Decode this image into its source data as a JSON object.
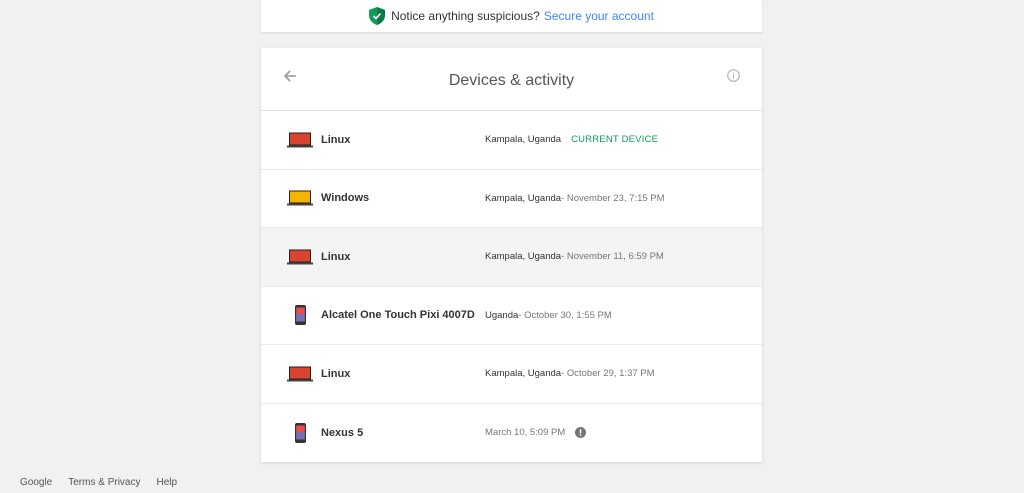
{
  "notice": {
    "text": "Notice anything suspicious?",
    "link": "Secure your account",
    "icon": "shield-icon"
  },
  "card": {
    "title": "Devices & activity",
    "back_icon": "arrow-back-icon",
    "info_icon": "info-icon"
  },
  "devices": [
    {
      "name": "Linux",
      "type": "laptop",
      "color": "#d9432f",
      "location": "Kampala, Uganda",
      "time": "",
      "current": "CURRENT DEVICE",
      "alert": false
    },
    {
      "name": "Windows",
      "type": "laptop",
      "color": "#f4b400",
      "location": "Kampala, Uganda",
      "time": " - November 23, 7:15 PM",
      "current": "",
      "alert": false
    },
    {
      "name": "Linux",
      "type": "laptop",
      "color": "#d9432f",
      "location": "Kampala, Uganda",
      "time": " - November 11, 6:59 PM",
      "current": "",
      "alert": false
    },
    {
      "name": "Alcatel One Touch Pixi 4007D",
      "type": "phone",
      "color": "#e84d4d",
      "location": "Uganda",
      "time": " - October 30, 1:55 PM",
      "current": "",
      "alert": false
    },
    {
      "name": "Linux",
      "type": "laptop",
      "color": "#d9432f",
      "location": "Kampala, Uganda",
      "time": " - October 29, 1:37 PM",
      "current": "",
      "alert": false
    },
    {
      "name": "Nexus 5",
      "type": "phone",
      "color": "#e84d4d",
      "location": "",
      "time": "March 10, 5:09 PM",
      "current": "",
      "alert": true
    }
  ],
  "footer": {
    "links": [
      "Google",
      "Terms & Privacy",
      "Help"
    ]
  },
  "colors": {
    "link": "#4285f4",
    "current_device": "#0f9d58",
    "shield": "#0f9d58"
  }
}
